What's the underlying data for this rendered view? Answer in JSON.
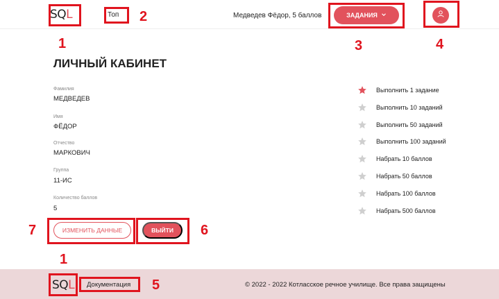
{
  "header": {
    "logo_sq": "SQ",
    "logo_l": "L",
    "top_link": "Топ",
    "user_name": "Медведев Фёдор, 5 баллов",
    "tasks_button": "ЗАДАНИЯ",
    "profile_icon": "user-icon"
  },
  "profile": {
    "title": "ЛИЧНЫЙ КАБИНЕТ",
    "fields": [
      {
        "label": "Фамилия",
        "value": "МЕДВЕДЕВ"
      },
      {
        "label": "Имя",
        "value": "ФЁДОР"
      },
      {
        "label": "Отчество",
        "value": "МАРКОВИЧ"
      },
      {
        "label": "Группа",
        "value": "11-ИС"
      },
      {
        "label": "Количество баллов",
        "value": "5"
      }
    ],
    "edit_button": "ИЗМЕНИТЬ ДАННЫЕ",
    "exit_button": "ВЫЙТИ"
  },
  "achievements": [
    {
      "label": "Выполнить 1 задание",
      "done": true
    },
    {
      "label": "Выполнить 10 заданий",
      "done": false
    },
    {
      "label": "Выполнить 50 заданий",
      "done": false
    },
    {
      "label": "Выполнить 100 заданий",
      "done": false
    },
    {
      "label": "Набрать 10 баллов",
      "done": false
    },
    {
      "label": "Набрать 50 баллов",
      "done": false
    },
    {
      "label": "Набрать 100 баллов",
      "done": false
    },
    {
      "label": "Набрать 500 баллов",
      "done": false
    }
  ],
  "footer": {
    "logo_sq": "SQ",
    "logo_l": "L",
    "doc_link": "Документация",
    "copyright": "© 2022 - 2022 Котласское речное училище. Все права защищены"
  },
  "annotations": [
    "1",
    "2",
    "3",
    "4",
    "7",
    "6",
    "1",
    "5"
  ],
  "colors": {
    "accent": "#e2525c",
    "annotation": "#e0141e",
    "footer_bg": "#ecd7d9",
    "star_done": "#e2525c",
    "star_pending": "#cfcfcf"
  }
}
